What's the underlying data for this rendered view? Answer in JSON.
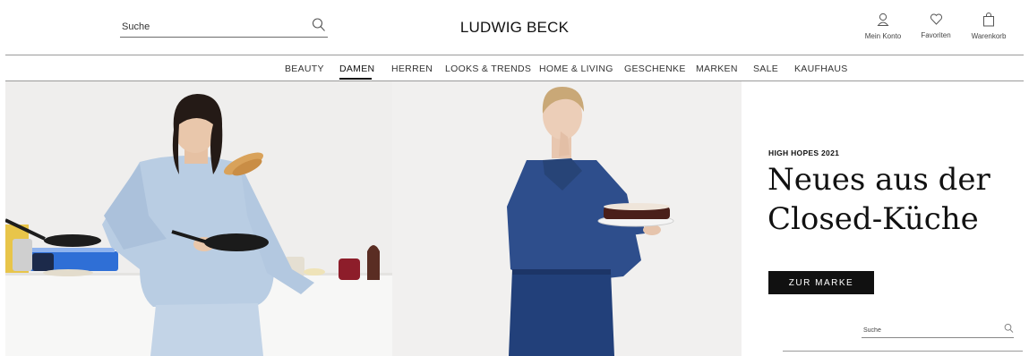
{
  "header": {
    "search_placeholder": "Suche",
    "logo": "LUDWIG BECK",
    "actions": [
      {
        "label": "Mein Konto",
        "icon": "user-icon"
      },
      {
        "label": "Favoriten",
        "icon": "heart-icon"
      },
      {
        "label": "Warenkorb",
        "icon": "shopping-bag-icon"
      }
    ]
  },
  "nav": {
    "items": [
      "BEAUTY",
      "DAMEN",
      "HERREN",
      "LOOKS & TRENDS",
      "HOME & LIVING",
      "GESCHENKE",
      "MARKEN",
      "SALE",
      "KAUFHAUS"
    ],
    "active": "DAMEN"
  },
  "hero": {
    "eyebrow": "HIGH HOPES 2021",
    "headline_line1": "Neues aus der",
    "headline_line2": "Closed-Küche",
    "cta_label": "ZUR MARKE",
    "search_placeholder": "Suche"
  },
  "colors": {
    "text": "#111111",
    "cta_background": "#111111",
    "cta_text": "#ffffff",
    "divider": "#9a9a9a",
    "denim_light": "#b9cde3",
    "denim_dark": "#2e4e8c"
  }
}
